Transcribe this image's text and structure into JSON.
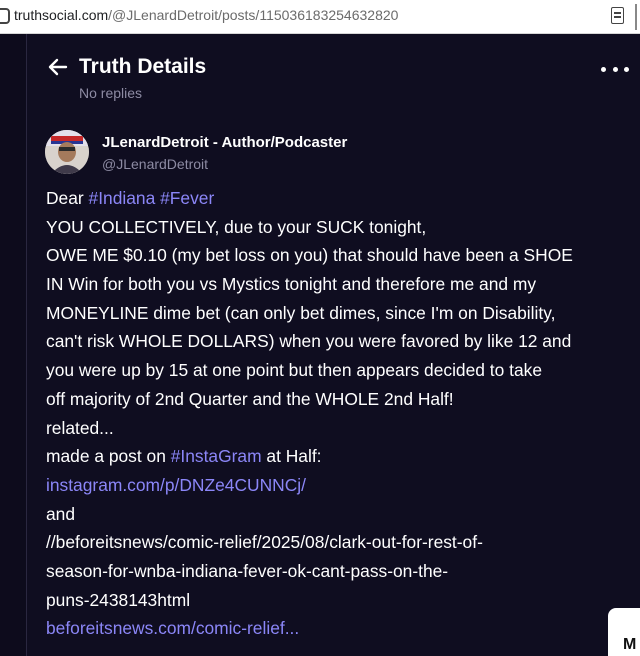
{
  "browser": {
    "url_domain": "truthsocial.com",
    "url_path": "/@JLenardDetroit/posts/115036183254632820"
  },
  "header": {
    "title": "Truth Details",
    "subtitle": "No replies"
  },
  "author": {
    "name": "JLenardDetroit - Author/Podcaster",
    "handle": "@JLenardDetroit"
  },
  "post": {
    "l1_a": "Dear ",
    "l1_tag1": "#Indiana",
    "l1_sp": " ",
    "l1_tag2": "#Fever",
    "l2": "YOU COLLECTIVELY, due to your SUCK tonight,",
    "l3": "OWE ME $0.10 (my bet loss on you) that should have been a SHOE",
    "l4": "IN Win for both you vs Mystics tonight and therefore me and my",
    "l5": "MONEYLINE dime bet (can only bet dimes, since I'm on Disability,",
    "l6": "can't risk WHOLE DOLLARS) when you were favored by like 12 and",
    "l7": "you were up by 15 at one point but then appears decided to take",
    "l8": "off majority of 2nd Quarter and the WHOLE 2nd Half!",
    "l9": "related...",
    "l10_a": "made a post on ",
    "l10_tag": "#InstaGram",
    "l10_b": " at Half:",
    "l11_link": "instagram.com/p/DNZe4CUNNCj/",
    "l12": "and",
    "l13": "//beforeitsnews/comic-relief/2025/08/clark-out-for-rest-of-",
    "l14": "season-for-wnba-indiana-fever-ok-cant-pass-on-the-",
    "l15": "puns-2438143html",
    "l16_link": "beforeitsnews.com/comic-relief..."
  },
  "side_card_letter": "M",
  "icons": {
    "back": "arrow-left-icon",
    "more": "more-horizontal-icon",
    "reader": "reader-mode-icon"
  },
  "colors": {
    "background": "#0d0b1c",
    "link": "#8b86f7",
    "muted": "#8d8ba3"
  }
}
